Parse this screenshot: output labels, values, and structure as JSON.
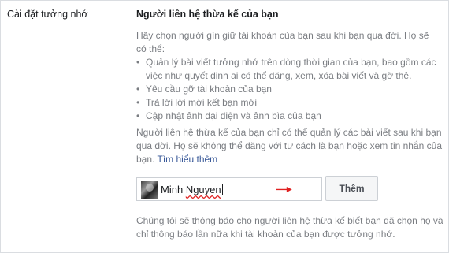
{
  "left": {
    "section_title": "Cài đặt tưởng nhớ"
  },
  "heading": "Người liên hệ thừa kế của bạn",
  "intro": "Hãy chọn người gìn giữ tài khoản của bạn sau khi bạn qua đời. Họ sẽ có thể:",
  "abilities": [
    "Quản lý bài viết tưởng nhớ trên dòng thời gian của bạn, bao gồm các việc như quyết định ai có thể đăng, xem, xóa bài viết và gỡ thẻ.",
    "Yêu cầu gỡ tài khoản của bạn",
    "Trả lời lời mời kết bạn mới",
    "Cập nhật ảnh đại diện và ảnh bìa của bạn"
  ],
  "limitation": "Người liên hệ thừa kế của bạn chỉ có thể quản lý các bài viết sau khi bạn qua đời. Họ sẽ không thể đăng với tư cách là bạn hoặc xem tin nhắn của bạn.",
  "learn_more": "Tìm hiểu thêm",
  "contact_input": {
    "first": "Minh",
    "last": "Nguyen"
  },
  "add_button": "Thêm",
  "notice": "Chúng tôi sẽ thông báo cho người liên hệ thừa kế biết bạn đã chọn họ và chỉ thông báo lần nữa khi tài khoản của bạn được tưởng nhớ.",
  "colors": {
    "arrow": "#e02020",
    "link": "#385898",
    "muted_text": "#7a7d82"
  },
  "icons": {
    "avatar": "profile-photo",
    "arrow": "red-arrow-right"
  }
}
